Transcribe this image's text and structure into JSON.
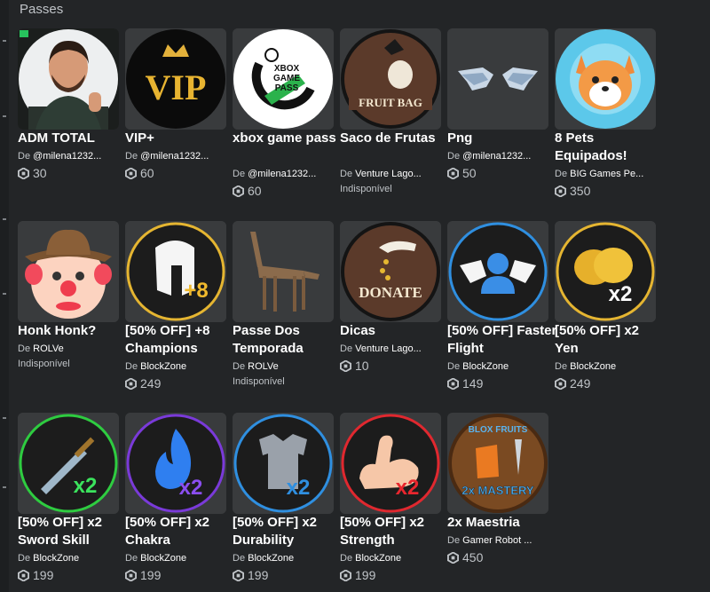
{
  "section_title": "Passes",
  "by_prefix": "De",
  "cards": [
    {
      "name": "ADM TOTAL",
      "creator": "@milena1232...",
      "price": "30",
      "unavailable": ""
    },
    {
      "name": "VIP+",
      "creator": "@milena1232...",
      "price": "60",
      "unavailable": ""
    },
    {
      "name": "xbox game pass",
      "creator": "@milena1232...",
      "price": "60",
      "unavailable": ""
    },
    {
      "name": "Saco de Frutas",
      "creator": "Venture Lago...",
      "price": "",
      "unavailable": "Indisponível",
      "thumb_text": "FRUIT BAG"
    },
    {
      "name": "Png",
      "creator": "@milena1232...",
      "price": "50",
      "unavailable": ""
    },
    {
      "name": "8 Pets Equipados!",
      "creator": "BIG Games Pe...",
      "price": "350",
      "unavailable": ""
    },
    {
      "name": "Honk Honk?",
      "creator": "ROLVe",
      "price": "",
      "unavailable": "Indisponível"
    },
    {
      "name": "[50% OFF] +8 Champions",
      "creator": "BlockZone",
      "price": "249",
      "unavailable": "",
      "thumb_text": "+8"
    },
    {
      "name": "Passe Dos Temporada",
      "creator": "ROLVe",
      "price": "",
      "unavailable": "Indisponível"
    },
    {
      "name": "Dicas",
      "creator": "Venture Lago...",
      "price": "10",
      "unavailable": "",
      "thumb_text": "DONATE"
    },
    {
      "name": "[50% OFF] Faster Flight",
      "creator": "BlockZone",
      "price": "149",
      "unavailable": ""
    },
    {
      "name": "[50% OFF] x2 Yen",
      "creator": "BlockZone",
      "price": "249",
      "unavailable": "",
      "thumb_text": "x2"
    },
    {
      "name": "[50% OFF] x2 Sword Skill",
      "creator": "BlockZone",
      "price": "199",
      "unavailable": "",
      "thumb_text": "x2"
    },
    {
      "name": "[50% OFF] x2 Chakra",
      "creator": "BlockZone",
      "price": "199",
      "unavailable": "",
      "thumb_text": "x2"
    },
    {
      "name": "[50% OFF] x2 Durability",
      "creator": "BlockZone",
      "price": "199",
      "unavailable": "",
      "thumb_text": "x2"
    },
    {
      "name": "[50% OFF] x2 Strength",
      "creator": "BlockZone",
      "price": "199",
      "unavailable": "",
      "thumb_text": "x2"
    },
    {
      "name": "2x Maestria",
      "creator": "Gamer Robot ...",
      "price": "450",
      "unavailable": "",
      "thumb_text": "2x MASTERY",
      "thumb_text2": "BLOX FRUITS"
    }
  ],
  "vip_text": "VIP",
  "xbox_text": "XBOX GAME PASS",
  "colors": {
    "bg": "#232527",
    "card": "#393b3d",
    "muted": "#bfc3c7"
  }
}
